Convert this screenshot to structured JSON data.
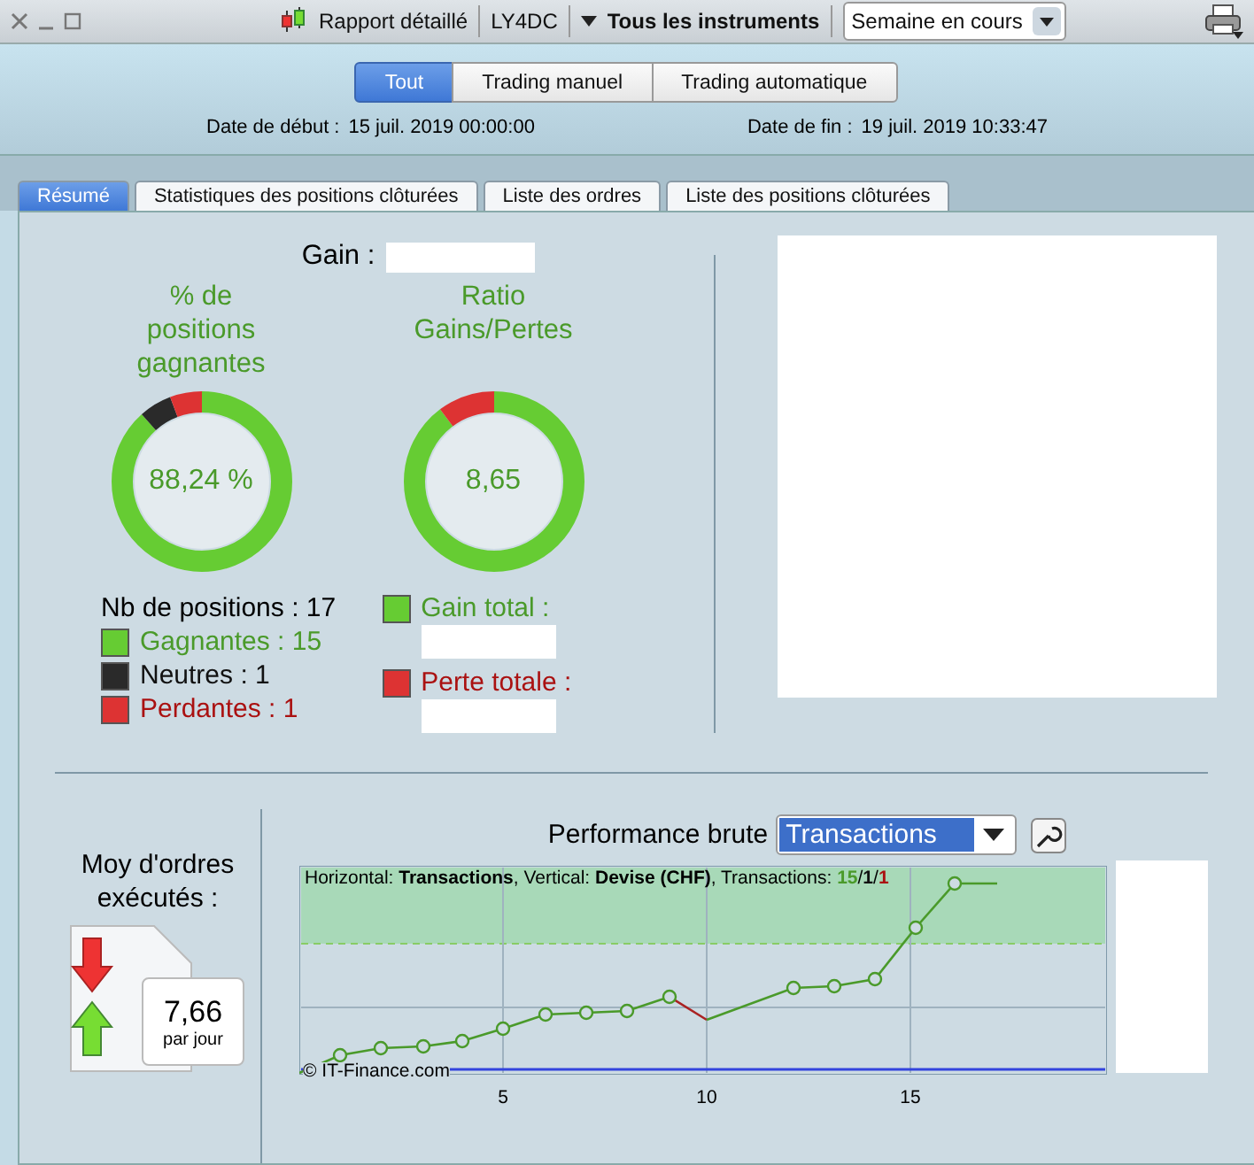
{
  "toolbar": {
    "report": "Rapport détaillé",
    "account": "LY4DC",
    "instruments": "Tous les instruments",
    "period": "Semaine en cours"
  },
  "filter_buttons": [
    {
      "label": "Tout",
      "selected": true
    },
    {
      "label": "Trading manuel",
      "selected": false
    },
    {
      "label": "Trading automatique",
      "selected": false
    }
  ],
  "dates": [
    {
      "label": "Date de début :",
      "value": "15 juil. 2019 00:00:00"
    },
    {
      "label": "Date de fin :",
      "value": "19 juil. 2019 10:33:47"
    }
  ],
  "tabs": [
    {
      "label": "Résumé",
      "selected": true
    },
    {
      "label": "Statistiques des positions clôturées",
      "selected": false
    },
    {
      "label": "Liste des ordres",
      "selected": false
    },
    {
      "label": "Liste des positions clôturées",
      "selected": false
    }
  ],
  "gain": {
    "label": "Gain :"
  },
  "donuts": [
    {
      "title": "% de positions gagnantes",
      "center": "88,24 %"
    },
    {
      "title": "Ratio Gains/Pertes",
      "center": "8,65"
    }
  ],
  "positions": {
    "count": "Nb de positions : 17",
    "legend": [
      {
        "kind": "win",
        "label": "Gagnantes : 15"
      },
      {
        "kind": "neutral",
        "label": "Neutres : 1"
      },
      {
        "kind": "loss",
        "label": "Perdantes : 1"
      }
    ]
  },
  "totals": [
    {
      "kind": "win",
      "label": "Gain total :"
    },
    {
      "kind": "loss",
      "label": "Perte totale :"
    }
  ],
  "average": {
    "title": "Moy d'ordres exécutés :",
    "value": "7,66",
    "unit": "par jour"
  },
  "performance": {
    "label": "Performance brute",
    "selection": "Transactions",
    "header": "Horizontal: **Transactions**, Vertical: **Devise (CHF)**, Transactions:",
    "separator": "/",
    "counts": [
      {
        "kind": "win",
        "value": "15"
      },
      {
        "kind": "neutral",
        "value": "1"
      },
      {
        "kind": "loss",
        "value": "1"
      }
    ],
    "copyright": "© IT-Finance.com",
    "xtick_labels": [
      "5",
      "10",
      "15"
    ]
  }
}
